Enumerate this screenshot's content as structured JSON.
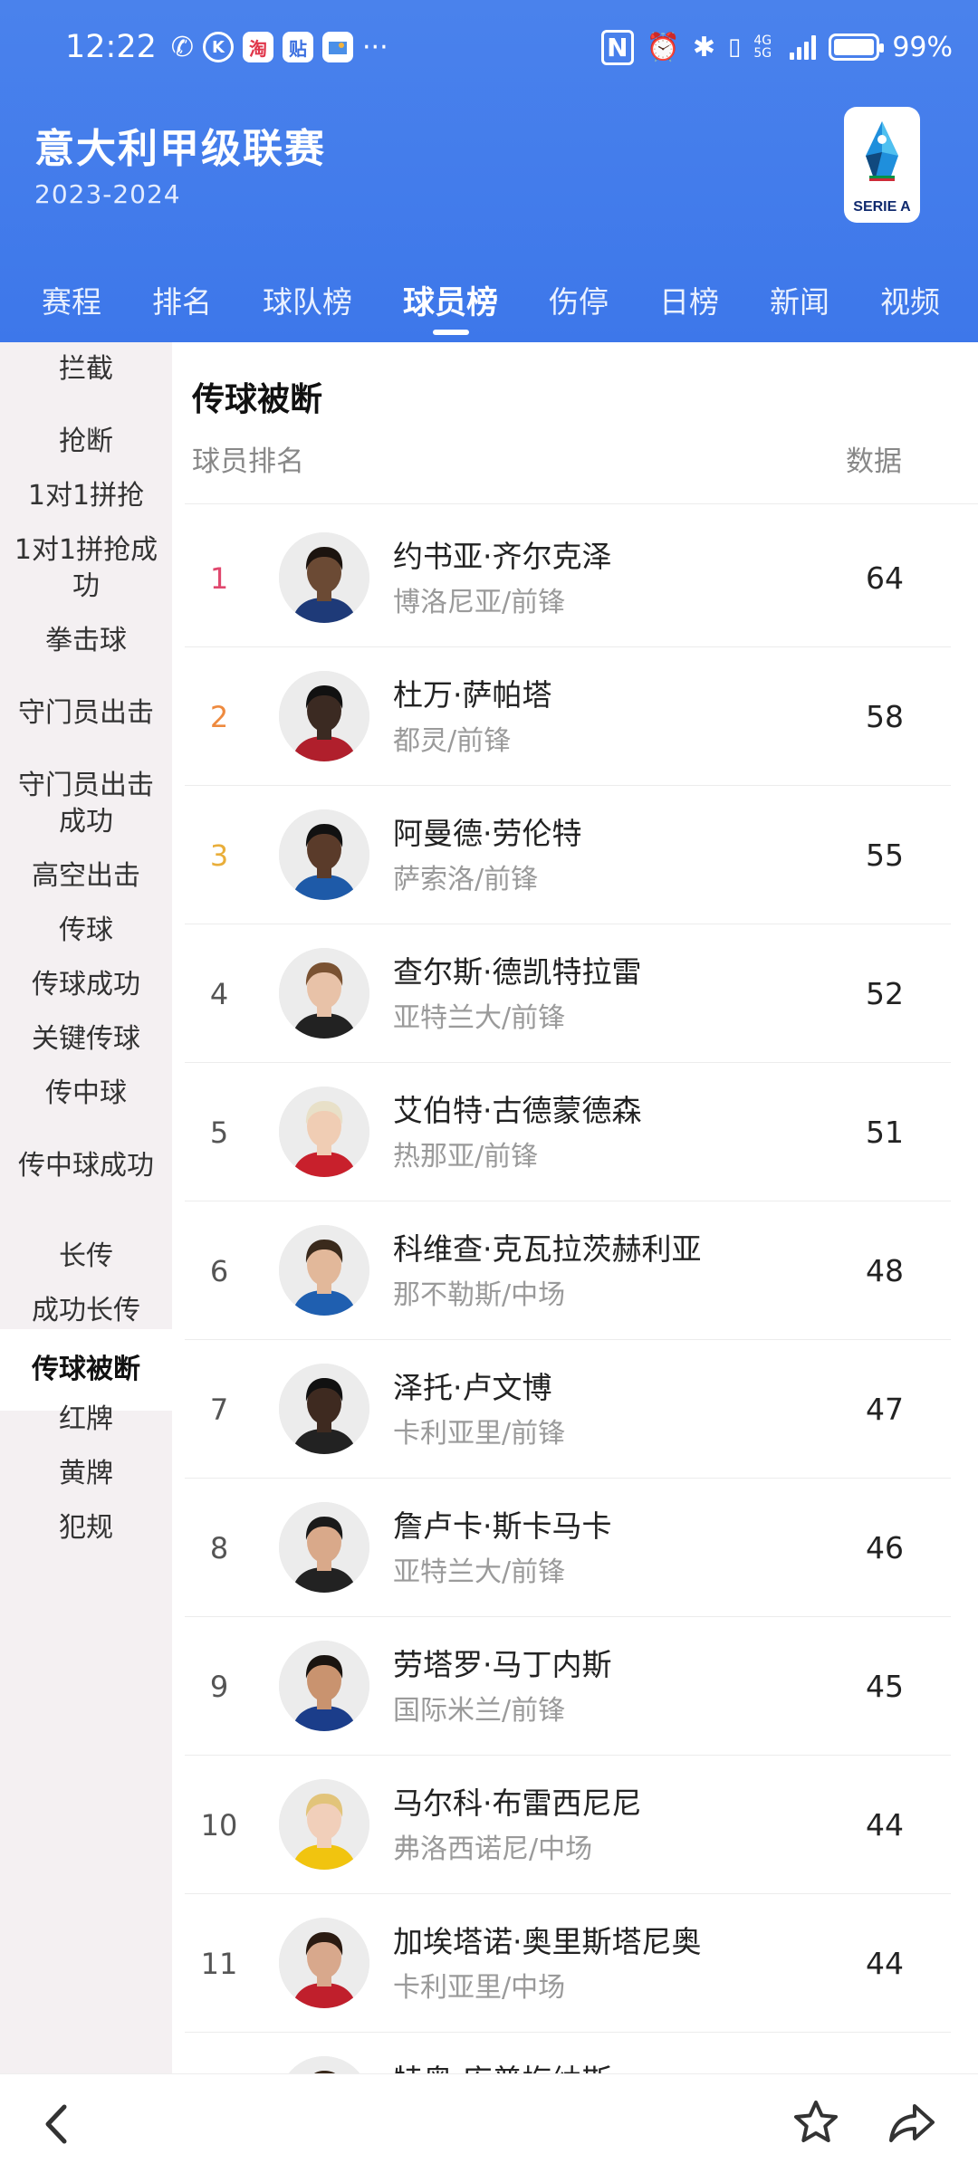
{
  "status_bar": {
    "time": "12:22",
    "app_badges": [
      "淘",
      "贴"
    ],
    "network": "4G 5G",
    "battery": "99%",
    "battery_level": 0.99
  },
  "header": {
    "league_title": "意大利甲级联赛",
    "season": "2023-2024",
    "logo_text": "SERIE A"
  },
  "tabs": [
    {
      "label": "赛程"
    },
    {
      "label": "排名"
    },
    {
      "label": "球队榜"
    },
    {
      "label": "球员榜",
      "active": true
    },
    {
      "label": "伤停"
    },
    {
      "label": "日榜"
    },
    {
      "label": "新闻"
    },
    {
      "label": "视频"
    }
  ],
  "sidebar": {
    "items": [
      {
        "label": "拦截"
      },
      {
        "label": "抢断"
      },
      {
        "label": "1对1拼抢"
      },
      {
        "label": "1对1拼抢成功"
      },
      {
        "label": "拳击球"
      },
      {
        "label": "守门员出击"
      },
      {
        "label": "守门员出击成功"
      },
      {
        "label": "高空出击"
      },
      {
        "label": "传球"
      },
      {
        "label": "传球成功"
      },
      {
        "label": "关键传球"
      },
      {
        "label": "传中球"
      },
      {
        "label": "传中球成功"
      },
      {
        "label": "长传"
      },
      {
        "label": "成功长传"
      },
      {
        "label": "传球被断",
        "active": true
      },
      {
        "label": "红牌"
      },
      {
        "label": "黄牌"
      },
      {
        "label": "犯规"
      }
    ]
  },
  "main": {
    "section_title": "传球被断",
    "col_left": "球员排名",
    "col_right": "数据",
    "rows": [
      {
        "rank": "1",
        "name": "约书亚·齐尔克泽",
        "team": "博洛尼亚/前锋",
        "value": "64"
      },
      {
        "rank": "2",
        "name": "杜万·萨帕塔",
        "team": "都灵/前锋",
        "value": "58"
      },
      {
        "rank": "3",
        "name": "阿曼德·劳伦特",
        "team": "萨索洛/前锋",
        "value": "55"
      },
      {
        "rank": "4",
        "name": "查尔斯·德凯特拉雷",
        "team": "亚特兰大/前锋",
        "value": "52"
      },
      {
        "rank": "5",
        "name": "艾伯特·古德蒙德森",
        "team": "热那亚/前锋",
        "value": "51"
      },
      {
        "rank": "6",
        "name": "科维查·克瓦拉茨赫利亚",
        "team": "那不勒斯/中场",
        "value": "48"
      },
      {
        "rank": "7",
        "name": "泽托·卢文博",
        "team": "卡利亚里/前锋",
        "value": "47"
      },
      {
        "rank": "8",
        "name": "詹卢卡·斯卡马卡",
        "team": "亚特兰大/前锋",
        "value": "46"
      },
      {
        "rank": "9",
        "name": "劳塔罗·马丁内斯",
        "team": "国际米兰/前锋",
        "value": "45"
      },
      {
        "rank": "10",
        "name": "马尔科·布雷西尼尼",
        "team": "弗洛西诺尼/中场",
        "value": "44"
      },
      {
        "rank": "11",
        "name": "加埃塔诺·奥里斯塔尼奥",
        "team": "卡利亚里/中场",
        "value": "44"
      },
      {
        "rank": "",
        "name": "特奥·库普梅纳斯",
        "team": "",
        "value": ""
      }
    ]
  },
  "colors": {
    "header_blue": "#3d77ea",
    "rank1": "#e0486e",
    "rank2": "#ee8a3f",
    "rank3": "#e9ae3a",
    "sidebar_bg": "#f4f0f2"
  },
  "icons": {
    "back": "back-arrow-icon",
    "favorite": "star-icon",
    "share": "share-icon"
  }
}
